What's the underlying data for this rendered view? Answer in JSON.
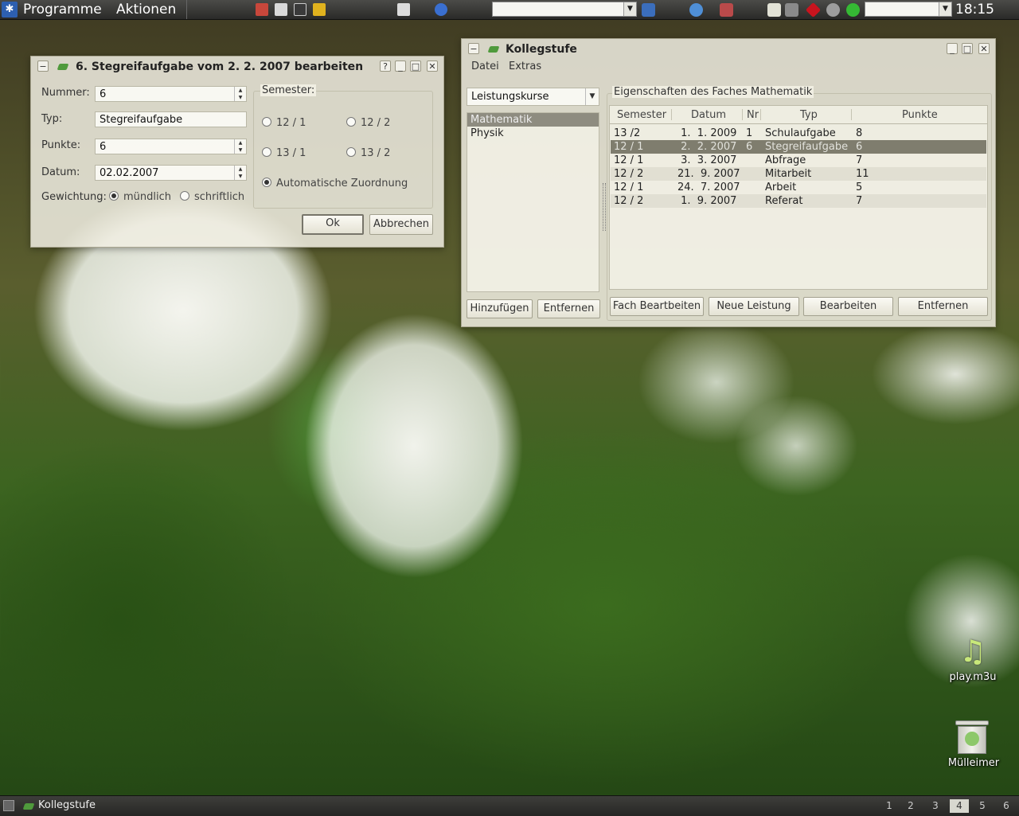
{
  "top_panel": {
    "menus": [
      "Programme",
      "Aktionen"
    ],
    "clock": "18:15",
    "launcher_icons": [
      "home-icon",
      "film-icon",
      "terminal-icon",
      "notes-icon",
      "phone-icon",
      "browser-icon"
    ],
    "tray_icons": [
      "monitor-icon",
      "refresh-icon",
      "network-icon",
      "clipboard-icon",
      "speaker-icon",
      "ruby-icon",
      "wrench-icon",
      "status-icon"
    ]
  },
  "dialog": {
    "title": "6. Stegreifaufgabe vom  2.  2. 2007 bearbeiten",
    "help": "?",
    "labels": {
      "nummer": "Nummer:",
      "typ": "Typ:",
      "punkte": "Punkte:",
      "datum": "Datum:",
      "gewichtung": "Gewichtung:"
    },
    "values": {
      "nummer": "6",
      "typ": "Stegreifaufgabe",
      "punkte": "6",
      "datum": "02.02.2007"
    },
    "gewichtung_options": [
      "mündlich",
      "schriftlich"
    ],
    "gewichtung_selected": "mündlich",
    "semester_title": "Semester:",
    "semester_options": [
      "12 / 1",
      "12 / 2",
      "13 / 1",
      "13 / 2"
    ],
    "auto_option": "Automatische Zuordnung",
    "semester_selected": "Automatische Zuordnung",
    "ok": "Ok",
    "cancel": "Abbrechen"
  },
  "main_window": {
    "title": "Kollegstufe",
    "menu": [
      "Datei",
      "Extras"
    ],
    "course_select": "Leistungskurse",
    "subjects": [
      "Mathematik",
      "Physik"
    ],
    "selected_subject": "Mathematik",
    "add": "Hinzufügen",
    "remove_subject": "Entfernen",
    "group_title": "Eigenschaften des Faches Mathematik",
    "columns": [
      "Semester",
      "Datum",
      "Nr",
      "Typ",
      "Punkte"
    ],
    "rows": [
      {
        "semester": "13 /2",
        "datum": " 1.  1. 2009",
        "nr": "1",
        "typ": "Schulaufgabe",
        "punkte": "8"
      },
      {
        "semester": "12 / 1",
        "datum": " 2.  2. 2007",
        "nr": "6",
        "typ": "Stegreifaufgabe",
        "punkte": "6"
      },
      {
        "semester": "12 / 1",
        "datum": " 3.  3. 2007",
        "nr": "",
        "typ": "Abfrage",
        "punkte": "7"
      },
      {
        "semester": "12 / 2",
        "datum": "21.  9. 2007",
        "nr": "",
        "typ": "Mitarbeit",
        "punkte": "11"
      },
      {
        "semester": "12 / 1",
        "datum": "24.  7. 2007",
        "nr": "",
        "typ": "Arbeit",
        "punkte": "5"
      },
      {
        "semester": "12 / 2",
        "datum": " 1.  9. 2007",
        "nr": "",
        "typ": "Referat",
        "punkte": "7"
      }
    ],
    "buttons": [
      "Fach Beartbeiten",
      "Neue Leistung",
      "Bearbeiten",
      "Entfernen"
    ]
  },
  "desktop_icons": [
    "play.m3u",
    "Mülleimer"
  ],
  "taskbar": {
    "task": "Kollegstufe",
    "pager": [
      "1",
      "2",
      "3",
      "4",
      "5",
      "6"
    ],
    "active_desktop": "4"
  }
}
